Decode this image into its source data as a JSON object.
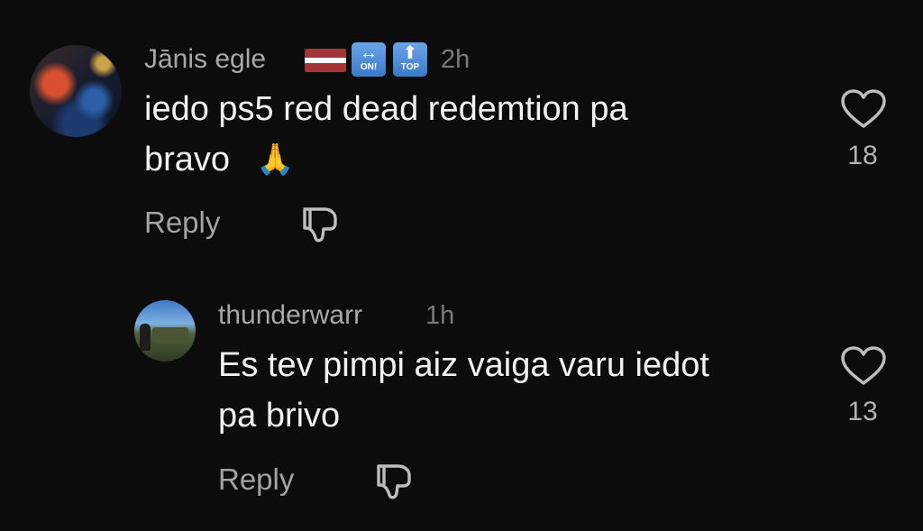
{
  "comments": [
    {
      "username": "Jānis egle",
      "badges": {
        "flag": "latvia-flag",
        "key1": {
          "glyph": "↔",
          "caption": "ON!"
        },
        "key2": {
          "glyph": "⬆",
          "caption": "TOP"
        }
      },
      "time": "2h",
      "text_line1": "iedo ps5 red dead redemtion pa",
      "text_line2": "bravo",
      "emoji": "🙏",
      "likes": "18",
      "reply_label": "Reply",
      "icons": [
        "heart-icon",
        "dislike-icon"
      ]
    },
    {
      "username": "thunderwarr",
      "time": "1h",
      "text_line1": "Es tev pimpi aiz vaiga varu iedot",
      "text_line2": "pa brivo",
      "likes": "13",
      "reply_label": "Reply",
      "icons": [
        "heart-icon",
        "dislike-icon"
      ]
    }
  ],
  "colors": {
    "background": "#0c0c0c",
    "username": "#a8a8a8",
    "text": "#f2f2f2",
    "muted": "#7a7a7a"
  }
}
